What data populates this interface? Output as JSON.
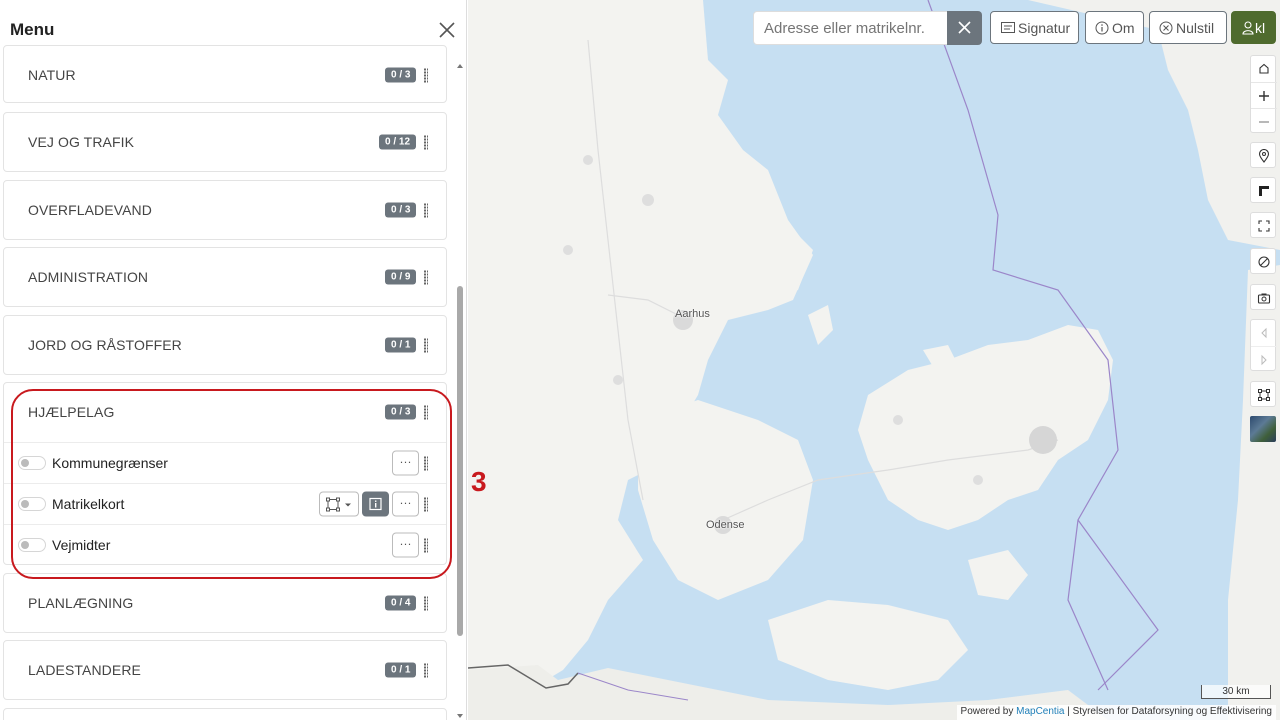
{
  "sidebar": {
    "title": "Menu",
    "groups": [
      {
        "label": "NATUR",
        "badge": "0 / 3"
      },
      {
        "label": "VEJ OG TRAFIK",
        "badge": "0 / 12"
      },
      {
        "label": "OVERFLADEVAND",
        "badge": "0 / 3"
      },
      {
        "label": "ADMINISTRATION",
        "badge": "0 / 9"
      },
      {
        "label": "JORD OG RÅSTOFFER",
        "badge": "0 / 1"
      },
      {
        "label": "HJÆLPELAG",
        "badge": "0 / 3",
        "layers": [
          {
            "label": "Kommunegrænser"
          },
          {
            "label": "Matrikelkort"
          },
          {
            "label": "Vejmidter"
          }
        ]
      },
      {
        "label": "PLANLÆGNING",
        "badge": "0 / 4"
      },
      {
        "label": "LADESTANDERE",
        "badge": "0 / 1"
      }
    ],
    "layer_toggles_on": false
  },
  "annotation": {
    "number": "3",
    "color": "#c8191e"
  },
  "search": {
    "placeholder": "Adresse eller matrikelnr."
  },
  "toolbar": {
    "signatur_label": "Signatur",
    "om_label": "Om",
    "nulstil_label": "Nulstil",
    "user_label": "kl"
  },
  "map": {
    "cities": [
      "Aarhus",
      "Odense"
    ],
    "scale_label": "30 km",
    "attribution_prefix": "Powered by ",
    "attribution_link": "MapCentia",
    "attribution_suffix": " | Styrelsen for Dataforsyning og Effektivisering",
    "colors": {
      "sea": "#c6dff2",
      "land": "#f3f3f0",
      "border": "#9b86c9"
    }
  },
  "controls": [
    "home-icon",
    "zoom-in-icon",
    "zoom-out-icon",
    "location-pin-icon",
    "baselayer-corner-icon",
    "fullscreen-icon",
    "clear-icon",
    "camera-icon",
    "back-icon",
    "forward-icon",
    "draw-polygon-icon"
  ]
}
